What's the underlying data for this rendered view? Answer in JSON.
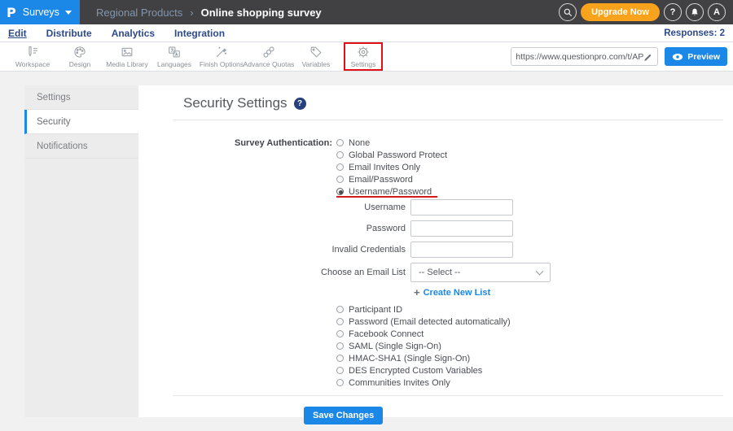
{
  "colors": {
    "brand_blue": "#1b87e6",
    "topbar_dark": "#414143",
    "accent_orange": "#f9a21b",
    "navy_text": "#2d4a8a",
    "annotation_red": "#e30f17",
    "underline_red": "#d51a1a"
  },
  "topbar": {
    "logo": "P",
    "app_menu_label": "Surveys",
    "breadcrumb": {
      "parent": "Regional Products",
      "separator": "›",
      "current": "Online shopping survey"
    },
    "upgrade_label": "Upgrade Now",
    "help_label": "?",
    "avatar_label": "A"
  },
  "nav": {
    "tabs": [
      "Edit",
      "Distribute",
      "Analytics",
      "Integration"
    ],
    "active_tab": "Edit",
    "responses_label": "Responses: 2"
  },
  "toolbar": {
    "items": [
      {
        "label": "Workspace",
        "icon": "workspace-icon"
      },
      {
        "label": "Design",
        "icon": "palette-icon"
      },
      {
        "label": "Media Library",
        "icon": "image-icon"
      },
      {
        "label": "Languages",
        "icon": "translate-icon"
      },
      {
        "label": "Finish Options",
        "icon": "wand-icon"
      },
      {
        "label": "Advance Quotas",
        "icon": "chain-icon"
      },
      {
        "label": "Variables",
        "icon": "tag-icon"
      },
      {
        "label": "Settings",
        "icon": "gear-icon"
      }
    ],
    "active_item": "Settings",
    "url_value": "https://www.questionpro.com/t/APNrFZ",
    "preview_label": "Preview"
  },
  "sidebar": {
    "items": [
      "Settings",
      "Security",
      "Notifications"
    ],
    "active": "Security"
  },
  "main": {
    "title": "Security Settings",
    "auth_label": "Survey Authentication:",
    "auth_options": [
      "None",
      "Global Password Protect",
      "Email Invites Only",
      "Email/Password",
      "Username/Password"
    ],
    "selected_option": "Username/Password",
    "fields": [
      {
        "label": "Username",
        "value": ""
      },
      {
        "label": "Password",
        "value": ""
      },
      {
        "label": "Invalid Credentials",
        "value": ""
      }
    ],
    "email_list": {
      "label": "Choose an Email List",
      "selected": "-- Select --"
    },
    "create_list": {
      "plus": "+",
      "label": "Create New List"
    },
    "more_options": [
      "Participant ID",
      "Password (Email detected automatically)",
      "Facebook Connect",
      "SAML (Single Sign-On)",
      "HMAC-SHA1 (Single Sign-On)",
      "DES Encrypted Custom Variables",
      "Communities Invites Only"
    ],
    "save_label": "Save Changes"
  }
}
